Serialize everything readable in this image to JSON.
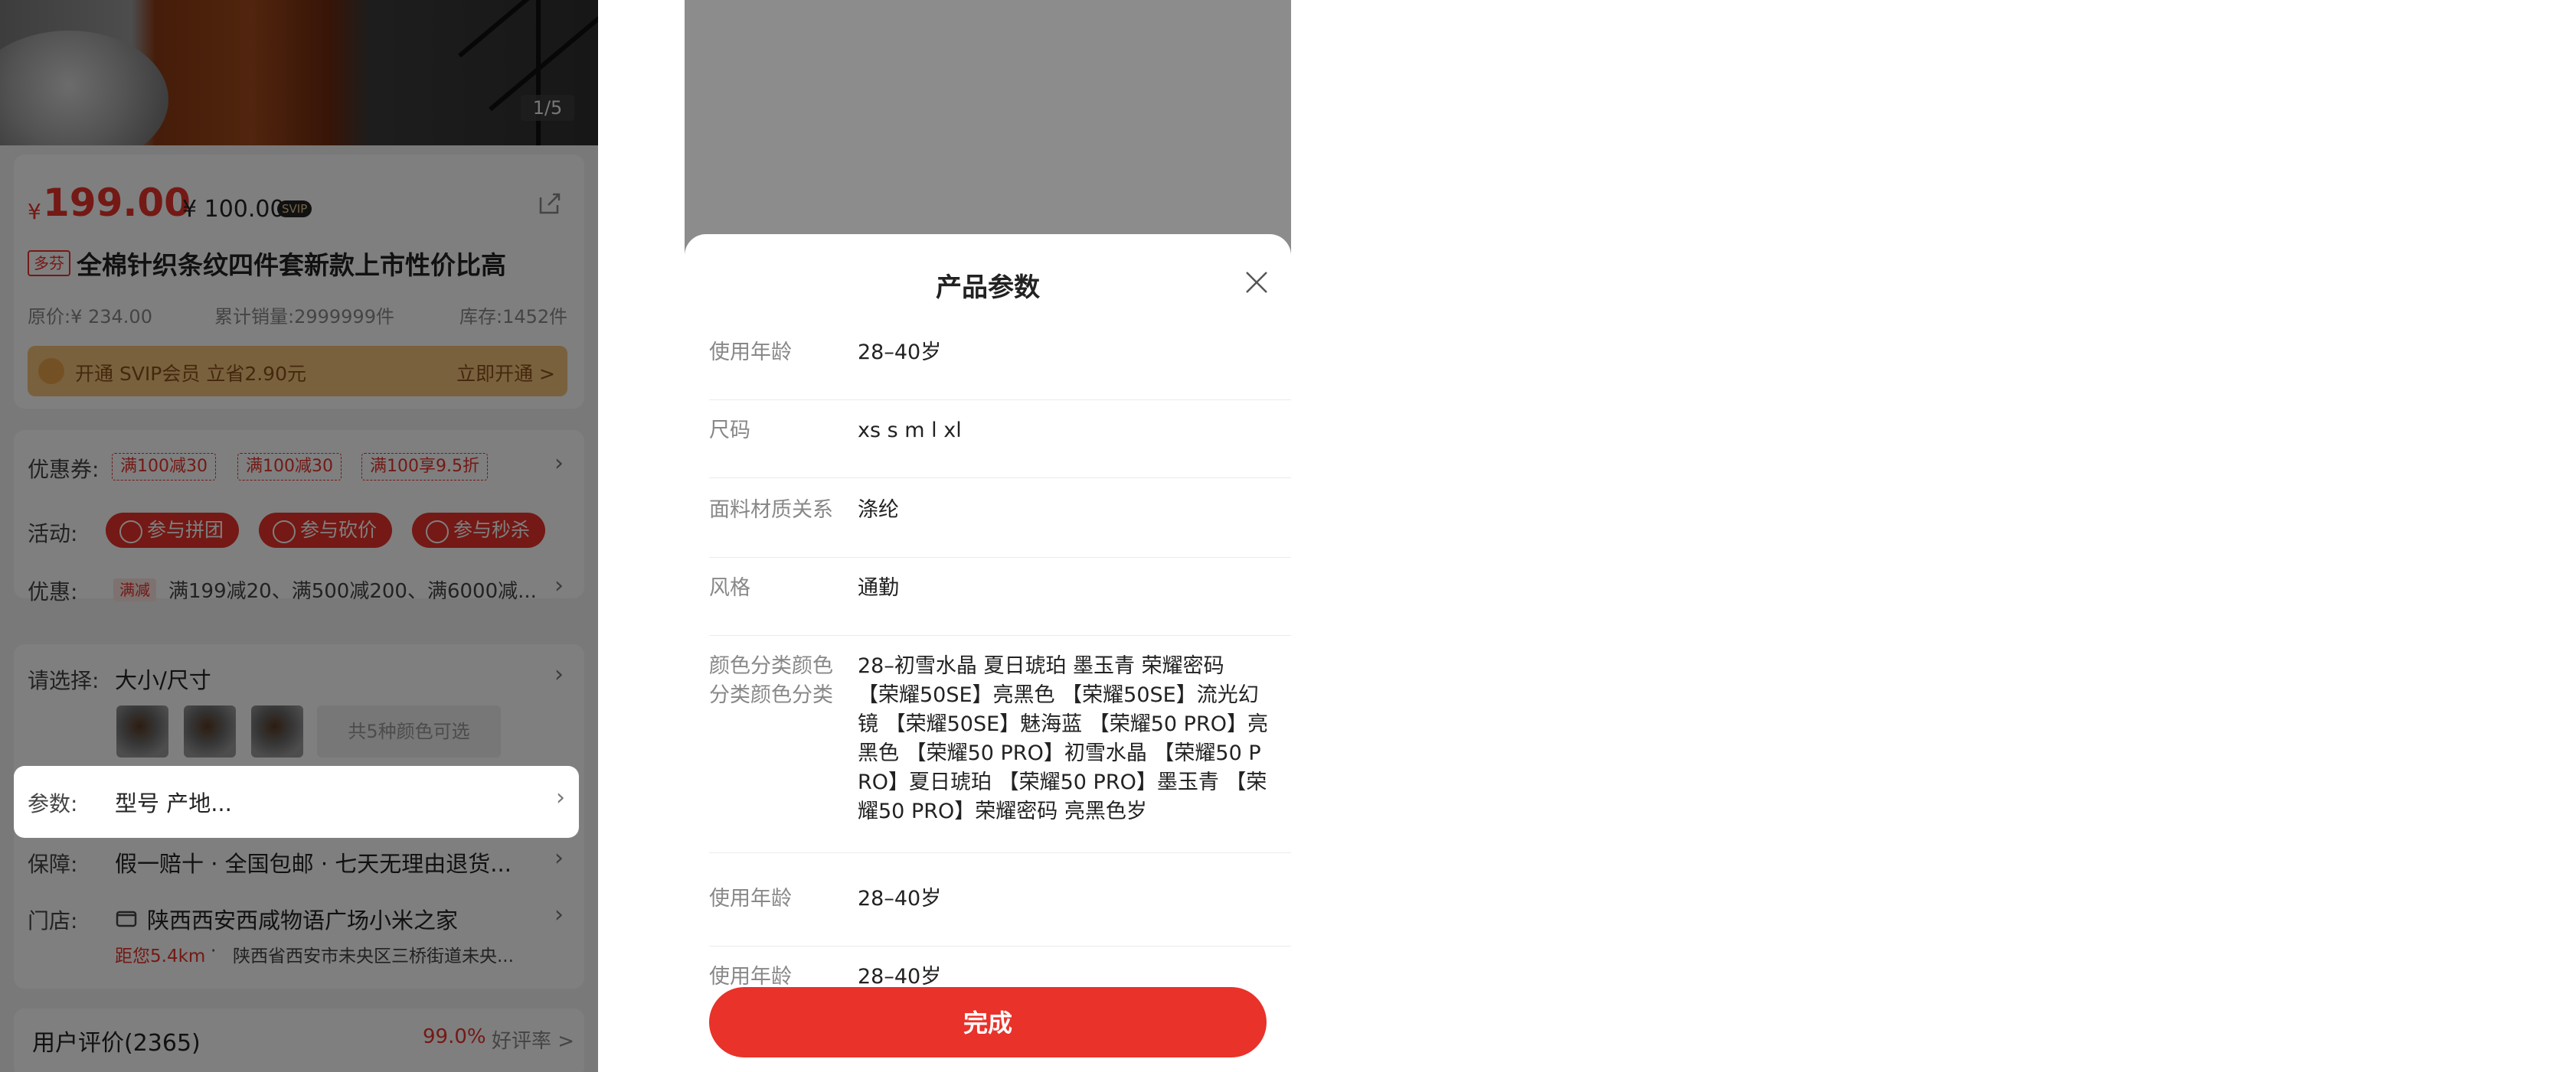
{
  "product": {
    "image_pager": "1/5",
    "currency": "¥",
    "price": "199.00",
    "vip_price": "¥ 100.00",
    "vip_badge": "SVIP",
    "shop_tag": "多芬",
    "title": "全棉针织条纹四件套新款上市性价比高",
    "original_price": "原价:¥ 234.00",
    "sales": "累计销量:2999999件",
    "stock": "库存:1452件",
    "svip_banner": {
      "text": "开通 SVIP会员 立省2.90元",
      "action": "立即开通 >"
    }
  },
  "promotions": {
    "coupon_label": "优惠券:",
    "coupons": [
      "满100减30",
      "满100减30",
      "满100享9.5折"
    ],
    "activity_label": "活动:",
    "activities": [
      "参与拼团",
      "参与砍价",
      "参与秒杀"
    ],
    "discount_label": "优惠:",
    "discount_tag": "满减",
    "discount_text": "满199减20、满500减200、满6000减..."
  },
  "options": {
    "select_label": "请选择:",
    "select_value": "大小/尺寸",
    "more_colors": "共5种颜色可选",
    "param_label": "参数:",
    "param_value": "型号 产地...",
    "guarantee_label": "保障:",
    "guarantee_value": "假一赔十 · 全国包邮 · 七天无理由退货...",
    "store_label": "门店:",
    "store_name": "陕西西安西咸物语广场小米之家",
    "store_distance": "距您5.4km",
    "store_address": "陕西省西安市未央区三桥街道未央..."
  },
  "reviews": {
    "title": "用户评价(2365)",
    "rate": "99.0%",
    "rate_label": "好评率 >"
  },
  "spec_sheet": {
    "title": "产品参数",
    "rows": [
      {
        "label": "使用年龄",
        "value": "28–40岁"
      },
      {
        "label": "尺码",
        "value": "xs s m l xl"
      },
      {
        "label": "面料材质关系",
        "value": "涤纶"
      },
      {
        "label": "风格",
        "value": "通勤"
      },
      {
        "label": "颜色分类颜色分类颜色分类",
        "value": "28–初雪水晶 夏日琥珀 墨玉青 荣耀密码 【荣耀50SE】亮黑色 【荣耀50SE】流光幻镜 【荣耀50SE】魅海蓝 【荣耀50 PRO】亮黑色 【荣耀50 PRO】初雪水晶 【荣耀50 PRO】夏日琥珀 【荣耀50 PRO】墨玉青 【荣耀50 PRO】荣耀密码 亮黑色岁"
      },
      {
        "label": "使用年龄",
        "value": "28–40岁"
      },
      {
        "label": "使用年龄",
        "value": "28–40岁"
      }
    ],
    "done_label": "完成"
  }
}
